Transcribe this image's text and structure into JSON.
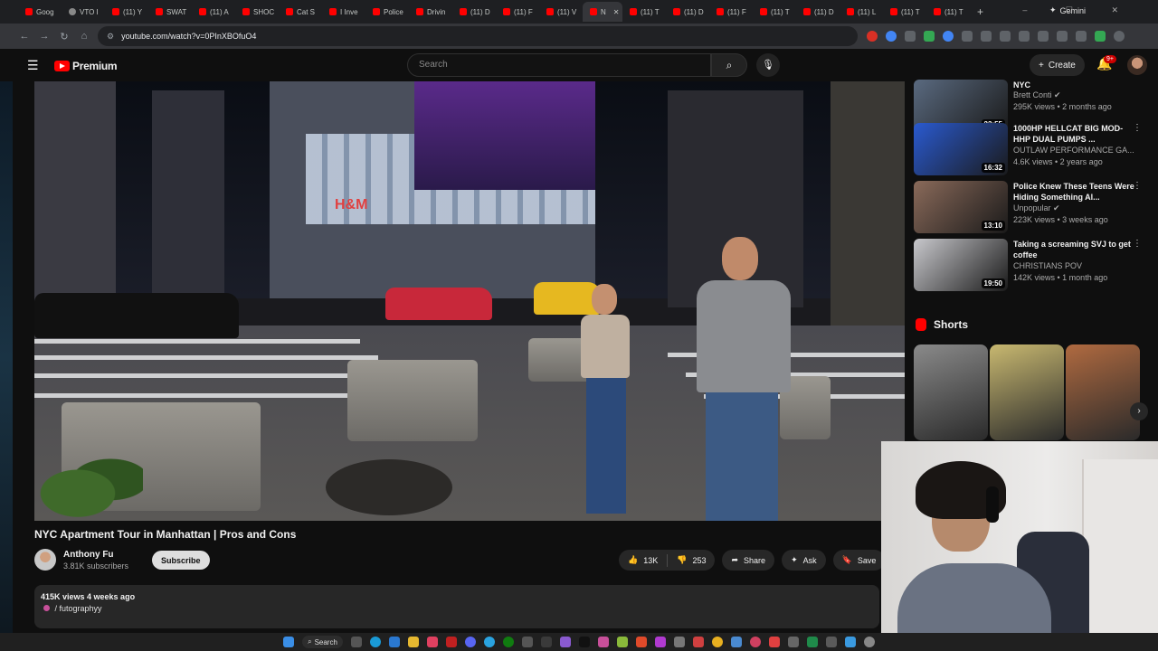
{
  "browser": {
    "tabs": [
      {
        "label": "Goog"
      },
      {
        "label": "VTO I"
      },
      {
        "label": "(11) Y"
      },
      {
        "label": "SWAT"
      },
      {
        "label": "(11) A"
      },
      {
        "label": "SHOC"
      },
      {
        "label": "Cat S"
      },
      {
        "label": "I Inve"
      },
      {
        "label": "Police"
      },
      {
        "label": "Drivin"
      },
      {
        "label": "(11) D"
      },
      {
        "label": "(11) F"
      },
      {
        "label": "(11) V"
      },
      {
        "label": "N"
      },
      {
        "label": "(11) T"
      },
      {
        "label": "(11) D"
      },
      {
        "label": "(11) F"
      },
      {
        "label": "(11) T"
      },
      {
        "label": "(11) D"
      },
      {
        "label": "(11) L"
      },
      {
        "label": "(11) T"
      },
      {
        "label": "(11) T"
      }
    ],
    "active_tab_index": 13,
    "new_tab_label": "+",
    "gemini_label": "Gemini",
    "url": "youtube.com/watch?v=0PInXBOfuO4"
  },
  "header": {
    "brand": "Premium",
    "search_placeholder": "Search",
    "create_label": "Create",
    "notif_count": "9+"
  },
  "video": {
    "title": "NYC Apartment Tour in Manhattan | Pros and Cons",
    "channel": "Anthony Fu",
    "subscribers": "3.81K subscribers",
    "subscribe_label": "Subscribe",
    "likes": "13K",
    "dislikes": "253",
    "share_label": "Share",
    "ask_label": "Ask",
    "save_label": "Save",
    "views_line": "415K views  4 weeks ago",
    "tag_line": "/ futographyу"
  },
  "sidebar": {
    "recommendations": [
      {
        "title": "NYC",
        "channel": "Brett Conti",
        "verified": true,
        "meta": "295K views • 2 months ago",
        "duration": "23:55",
        "color": "#5a6a80"
      },
      {
        "title": "1000HP HELLCAT BIG MOD-HHP DUAL PUMPS ...",
        "channel": "OUTLAW PERFORMANCE GA...",
        "verified": false,
        "meta": "4.6K views • 2 years ago",
        "duration": "16:32",
        "color": "#2a5ad0"
      },
      {
        "title": "Police Knew These Teens Were Hiding Something Al...",
        "channel": "Unpopular",
        "verified": true,
        "meta": "223K views • 3 weeks ago",
        "duration": "13:10",
        "color": "#8a6a5a"
      },
      {
        "title": "Taking a screaming SVJ to get coffee",
        "channel": "CHRISTIANS POV",
        "verified": false,
        "meta": "142K views • 1 month ago",
        "duration": "19:50",
        "color": "#c8c8cc"
      }
    ],
    "shorts_label": "Shorts",
    "shorts": [
      {
        "color": "#8a8a8a"
      },
      {
        "color": "#c8b870"
      },
      {
        "color": "#b06a40"
      }
    ]
  },
  "taskbar": {
    "search_label": "Search"
  }
}
